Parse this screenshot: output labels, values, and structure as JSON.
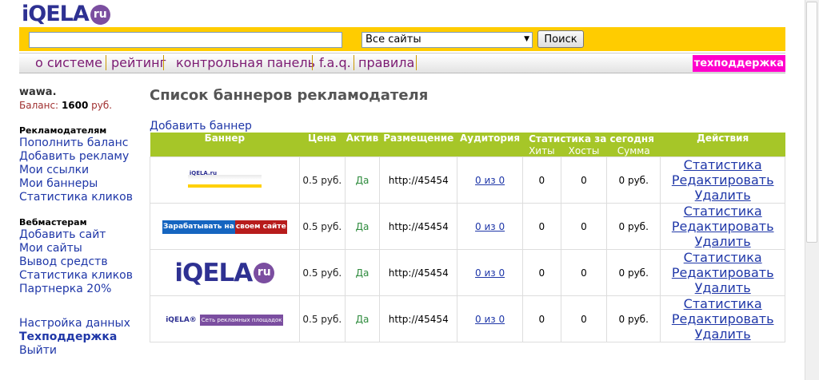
{
  "logo": {
    "word": "iQELA",
    "badge": "ru"
  },
  "search": {
    "value": "",
    "placeholder": "",
    "select_value": "Все сайты",
    "button": "Поиск"
  },
  "nav": {
    "items": [
      "о системе",
      "рейтинг",
      "контрольная панель",
      "f.a.q.",
      "правила"
    ],
    "support": "техподдержка"
  },
  "sidebar": {
    "user": "wawa.",
    "balance_label": "Баланс:",
    "balance_value": "1600",
    "balance_unit": "руб.",
    "advertisers_title": "Рекламодателям",
    "advertisers": [
      "Пополнить баланс",
      "Добавить рекламу",
      "Мои ссылки",
      "Мои баннеры",
      "Статистика кликов"
    ],
    "webmasters_title": "Вебмастерам",
    "webmasters": [
      "Добавить сайт",
      "Мои сайты",
      "Вывод средств",
      "Статистика кликов",
      "Партнерка 20%"
    ],
    "bottom": [
      "Настройка данных",
      "Техподдержка",
      "Выйти"
    ]
  },
  "main": {
    "title": "Список баннеров рекламодателя",
    "add_banner": "Добавить баннер",
    "headers": {
      "banner": "Баннер",
      "price": "Цена",
      "active": "Актив",
      "placement": "Размещение",
      "audience": "Аудитория",
      "stats": "Статистика за сегодня",
      "actions": "Действия",
      "hits": "Хиты",
      "hosts": "Хосты",
      "sum": "Сумма"
    },
    "rows": [
      {
        "banner_text": "iQELA.ru",
        "price": "0.5 руб.",
        "active": "Да",
        "placement": "http://45454",
        "audience": "0 из 0",
        "hits": "0",
        "hosts": "0",
        "sum": "0 руб."
      },
      {
        "banner_text_a": "Зарабатывать на",
        "banner_text_b": "своем сайте",
        "price": "0.5 руб.",
        "active": "Да",
        "placement": "http://45454",
        "audience": "0 из 0",
        "hits": "0",
        "hosts": "0",
        "sum": "0 руб."
      },
      {
        "banner_word": "iQELA",
        "banner_badge": "ru",
        "price": "0.5 руб.",
        "active": "Да",
        "placement": "http://45454",
        "audience": "0 из 0",
        "hits": "0",
        "hosts": "0",
        "sum": "0 руб."
      },
      {
        "banner_word": "iQELA®",
        "banner_text_b": "Сеть рекламных площадок",
        "price": "0.5 руб.",
        "active": "Да",
        "placement": "http://45454",
        "audience": "0 из 0",
        "hits": "0",
        "hosts": "0",
        "sum": "0 руб."
      }
    ],
    "actions": [
      "Статистика",
      "Редактировать",
      "Удалить"
    ]
  },
  "colors": {
    "brand": "#2e3192",
    "accent_yellow": "#ffcc00",
    "table_header": "#a6c628",
    "support_bg": "#ff00cc",
    "link": "#1f37a8",
    "nav_text": "#7b1a72"
  }
}
